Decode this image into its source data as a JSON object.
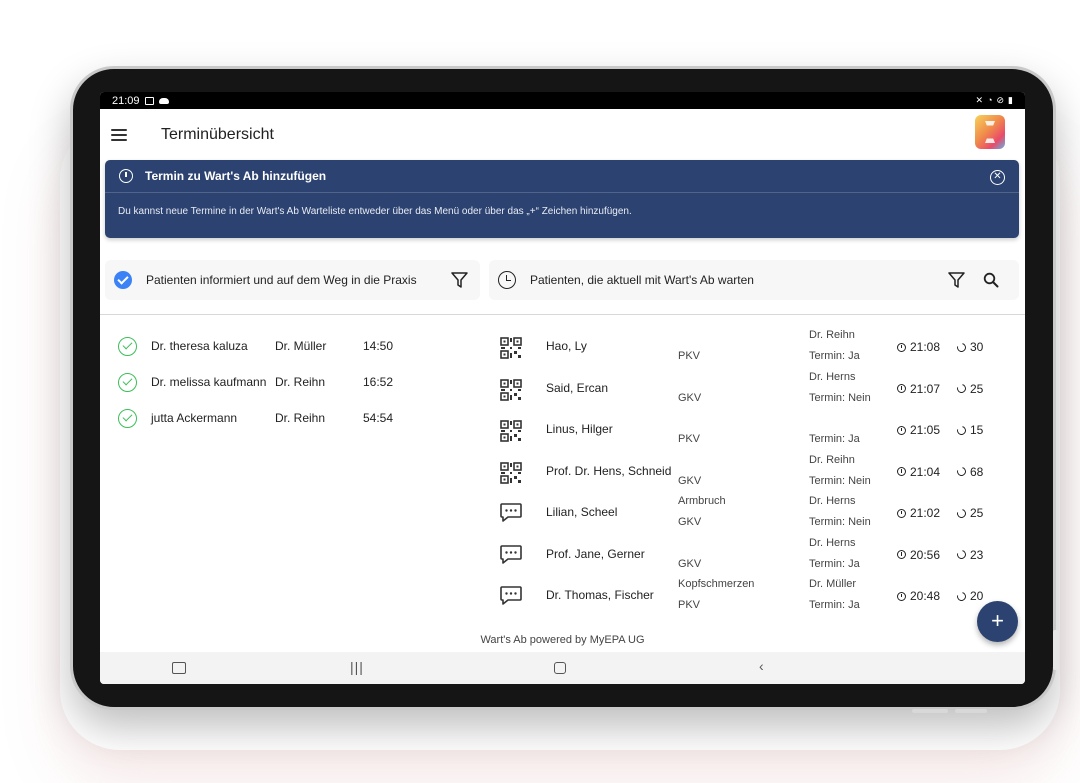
{
  "status_bar": {
    "time": "21:09"
  },
  "app_bar": {
    "title": "Terminübersicht"
  },
  "banner": {
    "title": "Termin zu Wart's Ab hinzufügen",
    "text": "Du kannst neue Termine in der Wart's Ab Warteliste entweder über das Menü oder über das „+“ Zeichen hinzufügen."
  },
  "left_panel": {
    "header": "Patienten informiert und auf dem Weg in die Praxis",
    "rows": [
      {
        "name": "Dr. theresa kaluza",
        "doctor": "Dr. Müller",
        "time": "14:50"
      },
      {
        "name": "Dr. melissa kaufmann",
        "doctor": "Dr. Reihn",
        "time": "16:52"
      },
      {
        "name": "jutta Ackermann",
        "doctor": "Dr. Reihn",
        "time": "54:54"
      }
    ]
  },
  "right_panel": {
    "header": "Patienten, die aktuell mit Wart's Ab warten",
    "rows": [
      {
        "icon": "qr-code-icon",
        "name": "Hao, Ly",
        "note": "",
        "insurance": "PKV",
        "doctor": "Dr. Reihn",
        "termin": "Termin: Ja",
        "arrival": "21:08",
        "wait": "30"
      },
      {
        "icon": "qr-code-icon",
        "name": "Said, Ercan",
        "note": "",
        "insurance": "GKV",
        "doctor": "Dr. Herns",
        "termin": "Termin: Nein",
        "arrival": "21:07",
        "wait": "25"
      },
      {
        "icon": "qr-code-icon",
        "name": "Linus, Hilger",
        "note": "",
        "insurance": "PKV",
        "doctor": "",
        "termin": "Termin: Ja",
        "arrival": "21:05",
        "wait": "15"
      },
      {
        "icon": "qr-code-icon",
        "name": "Prof. Dr. Hens, Schneid",
        "note": "",
        "insurance": "GKV",
        "doctor": "Dr. Reihn",
        "termin": "Termin: Nein",
        "arrival": "21:04",
        "wait": "68"
      },
      {
        "icon": "chat-icon",
        "name": "Lilian, Scheel",
        "note": "Armbruch",
        "insurance": "GKV",
        "doctor": "Dr. Herns",
        "termin": "Termin: Nein",
        "arrival": "21:02",
        "wait": "25"
      },
      {
        "icon": "chat-icon",
        "name": "Prof. Jane, Gerner",
        "note": "",
        "insurance": "GKV",
        "doctor": "Dr. Herns",
        "termin": "Termin: Ja",
        "arrival": "20:56",
        "wait": "23"
      },
      {
        "icon": "chat-icon",
        "name": "Dr. Thomas, Fischer",
        "note": "Kopfschmerzen",
        "insurance": "PKV",
        "doctor": "Dr. Müller",
        "termin": "Termin: Ja",
        "arrival": "20:48",
        "wait": "20"
      }
    ]
  },
  "footer": {
    "text": "Wart's Ab powered by MyEPA UG"
  },
  "fab": {
    "label": "+"
  },
  "colors": {
    "primary": "#2c4270",
    "check_blue": "#3b82f6",
    "check_green": "#3bbf58"
  }
}
